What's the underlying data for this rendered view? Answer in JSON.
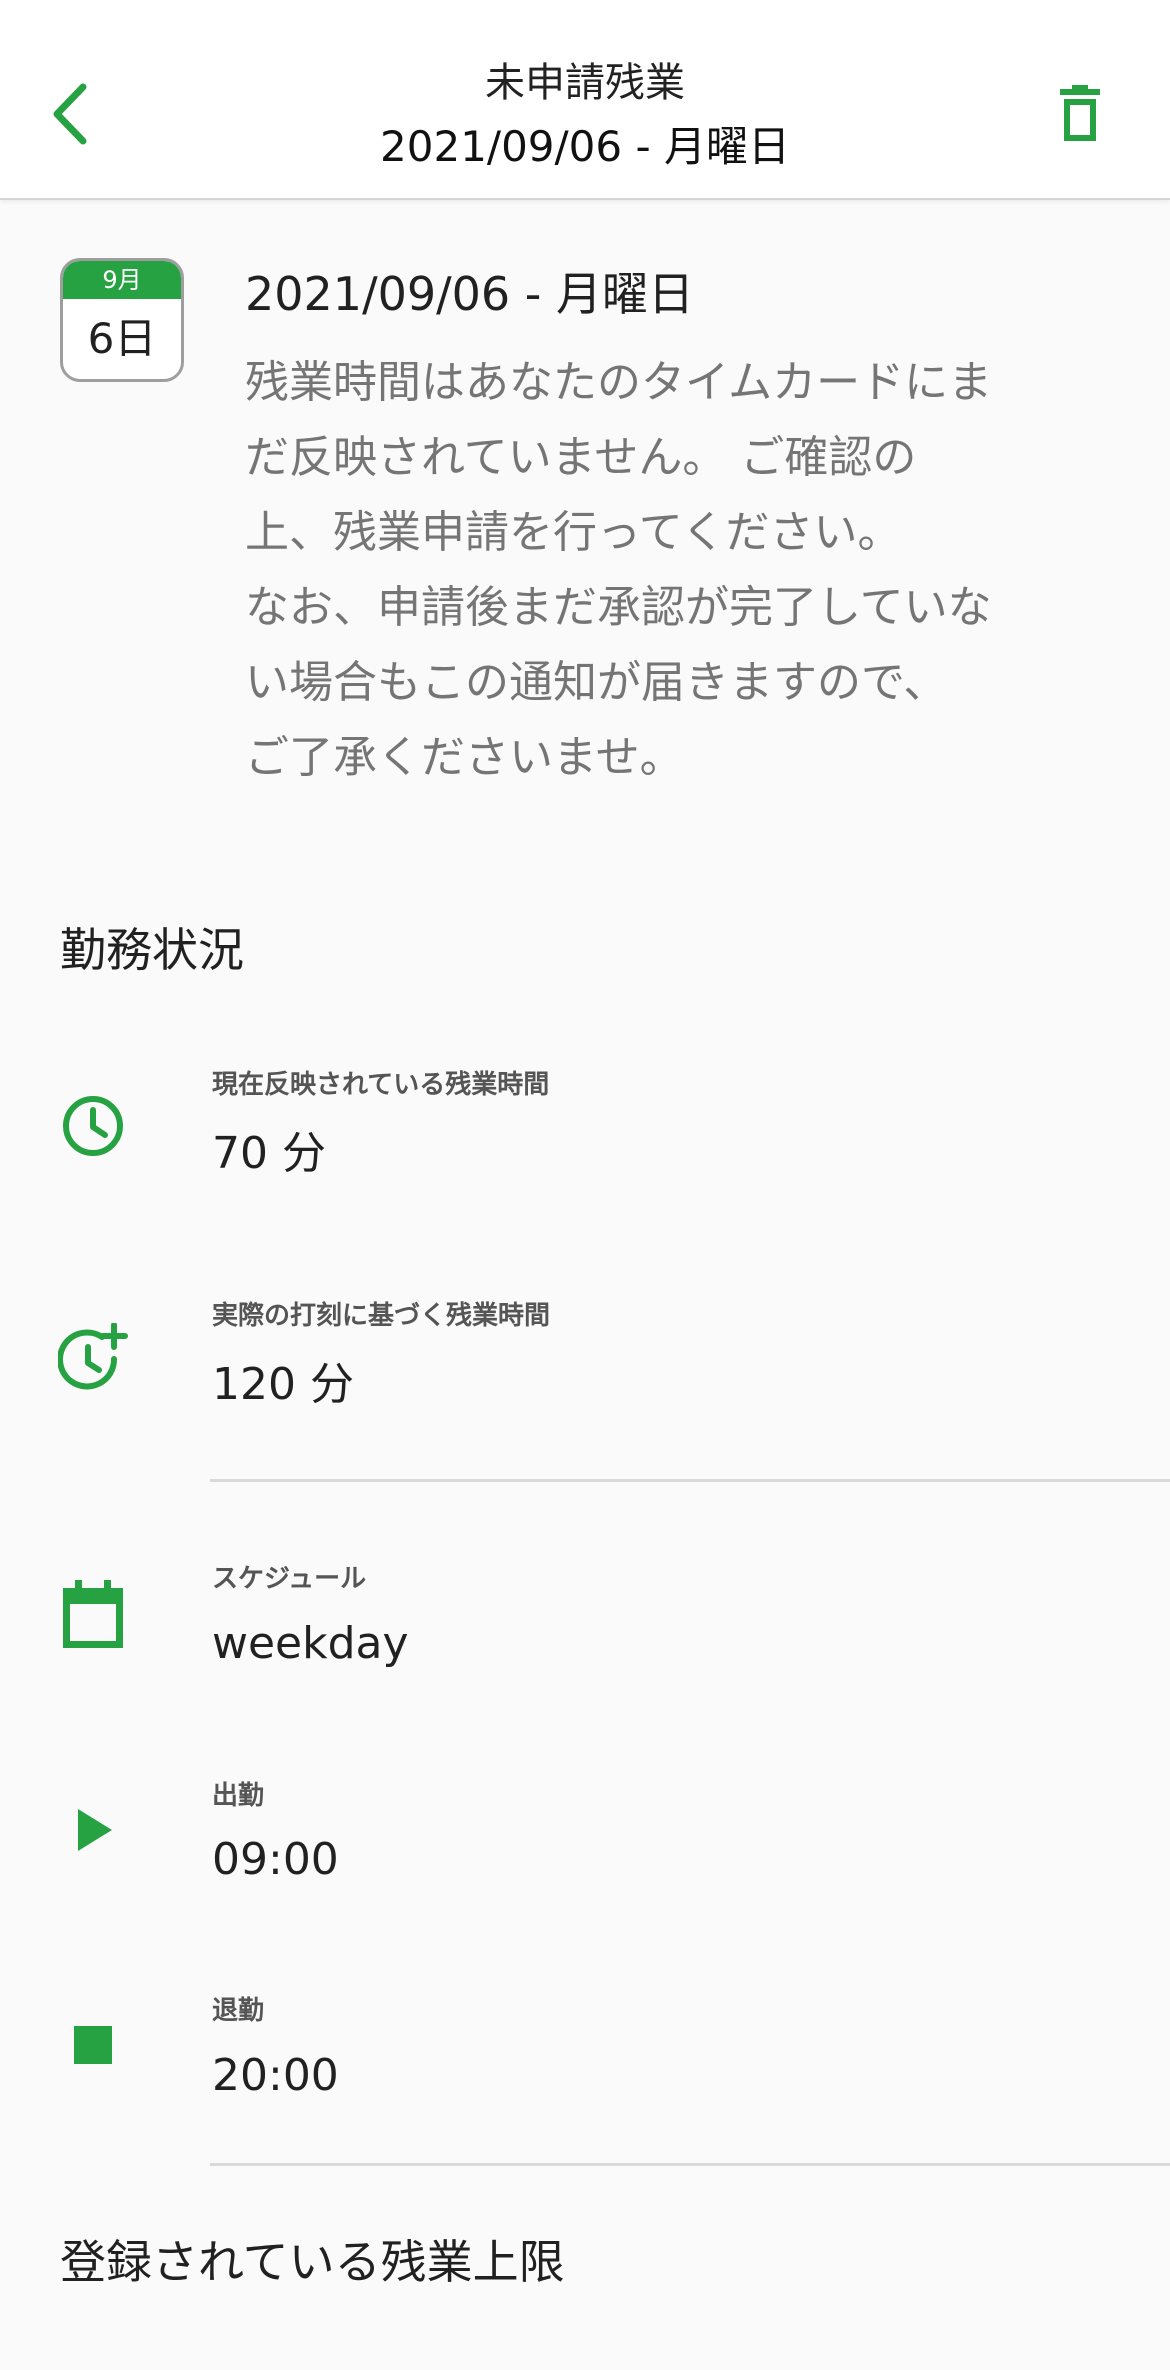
{
  "header": {
    "title": "未申請残業",
    "subtitle": "2021/09/06 - 月曜日",
    "back_icon": "chevron-left-icon",
    "delete_icon": "trash-icon"
  },
  "notice": {
    "calendar_month": "9月",
    "calendar_day": "6日",
    "date": "2021/09/06 - 月曜日",
    "message": "残業時間はあなたのタイムカードにま\nだ反映されていません。 ご確認の\n上、残業申請を行ってください。\nなお、申請後まだ承認が完了していな\nい場合もこの通知が届きますので、\nご了承くださいませ。"
  },
  "status": {
    "title": "勤務状況",
    "items": [
      {
        "icon": "clock-icon",
        "label": "現在反映されている残業時間",
        "value": "70 分"
      },
      {
        "icon": "clock-plus-icon",
        "label": "実際の打刻に基づく残業時間",
        "value": "120 分"
      },
      {
        "icon": "calendar-icon",
        "label": "スケジュール",
        "value": "weekday"
      },
      {
        "icon": "play-icon",
        "label": "出勤",
        "value": "09:00"
      },
      {
        "icon": "stop-icon",
        "label": "退勤",
        "value": "20:00"
      }
    ]
  },
  "limit": {
    "title": "登録されている残業上限"
  },
  "colors": {
    "accent": "#27a243",
    "background": "#fafafa",
    "header": "#ffffff"
  }
}
